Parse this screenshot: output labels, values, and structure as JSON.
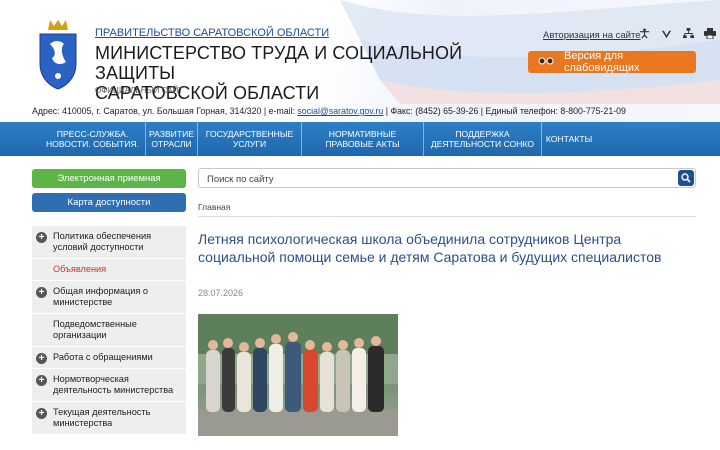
{
  "header": {
    "gov_link": "ПРАВИТЕЛЬСТВО САРАТОВСКОЙ ОБЛАСТИ",
    "ministry_line1": "МИНИСТЕРСТВО ТРУДА И СОЦИАЛЬНОЙ ЗАЩИТЫ",
    "ministry_line2": "САРАТОВСКОЙ ОБЛАСТИ",
    "official": "ОФИЦИАЛЬНЫЙ САЙТ",
    "auth_link": "Авторизация на сайте",
    "impaired_button": "Версия для слабовидящих",
    "icons": [
      "accessibility-icon",
      "vk-icon",
      "sitemap-icon",
      "print-icon"
    ],
    "address_pre": "Адрес: 410005, г. Саратов, ул. Большая Горная, 314/320 | e-mail: ",
    "email": "social@saratov.gov.ru",
    "address_post": " | Факс: (8452) 65-39-26 | Единый телефон: 8-800-775-21-09"
  },
  "nav": [
    {
      "line1": "ПРЕСС-СЛУЖБА.",
      "line2": "НОВОСТИ. СОБЫТИЯ."
    },
    {
      "line1": "РАЗВИТИЕ",
      "line2": "ОТРАСЛИ"
    },
    {
      "line1": "ГОСУДАРСТВЕННЫЕ",
      "line2": "УСЛУГИ"
    },
    {
      "line1": "НОРМАТИВНЫЕ",
      "line2": "ПРАВОВЫЕ АКТЫ"
    },
    {
      "line1": "ПОДДЕРЖКА",
      "line2": "ДЕЯТЕЛЬНОСТИ СОНКО"
    },
    {
      "line1": "КОНТАКТЫ",
      "line2": ""
    }
  ],
  "sidebar": {
    "reception_button": "Электронная приемная",
    "accessibility_map_button": "Карта доступности",
    "items": [
      {
        "label": "Политика обеспечения условий доступности",
        "expandable": true
      },
      {
        "label": "Объявления",
        "expandable": false,
        "active": true
      },
      {
        "label": "Общая информация о министерстве",
        "expandable": true
      },
      {
        "label": "Подведомственные организации",
        "expandable": false
      },
      {
        "label": "Работа с обращениями",
        "expandable": true
      },
      {
        "label": "Нормотворческая деятельность министерства",
        "expandable": true
      },
      {
        "label": "Текущая деятельность министерства",
        "expandable": true
      }
    ]
  },
  "search": {
    "placeholder": "Поиск по сайту"
  },
  "breadcrumb": "Главная",
  "article": {
    "title": "Летняя психологическая школа объединила сотрудников Центра социальной помощи семье и детям Саратова и будущих специалистов",
    "date": "28.07.2026"
  },
  "colors": {
    "nav_blue": "#2372b9",
    "orange": "#e8771f",
    "green": "#5db548",
    "title_blue": "#2a4f8a",
    "active_red": "#c0392b"
  }
}
